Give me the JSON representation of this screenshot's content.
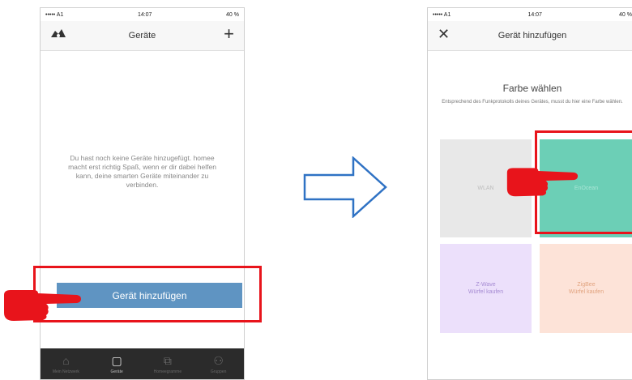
{
  "left_screen": {
    "status": {
      "carrier": "••••• A1",
      "time": "14:07",
      "battery": "40 %"
    },
    "nav": {
      "title": "Geräte",
      "left_icon": "homee-logo-icon",
      "right_icon": "plus-icon"
    },
    "empty_message": "Du hast noch keine Geräte hinzugefügt. homee macht erst richtig Spaß, wenn er dir dabei helfen kann, deine smarten Geräte miteinander zu verbinden.",
    "add_button_label": "Gerät hinzufügen",
    "tabs": [
      {
        "label": "Mein Netzwerk",
        "icon": "home-icon",
        "active": false
      },
      {
        "label": "Geräte",
        "icon": "devices-icon",
        "active": true
      },
      {
        "label": "Homeegramme",
        "icon": "homeegram-icon",
        "active": false
      },
      {
        "label": "Gruppen",
        "icon": "groups-icon",
        "active": false
      }
    ]
  },
  "right_screen": {
    "status": {
      "carrier": "••••• A1",
      "time": "14:07",
      "battery": "40 %"
    },
    "nav": {
      "title": "Gerät hinzufügen",
      "left_icon": "close-icon"
    },
    "heading": "Farbe wählen",
    "description": "Entsprechend des Funkprotokolls deines Gerätes, musst du hier eine Farbe wählen.",
    "tiles": [
      {
        "label": "WLAN",
        "color": "#e8e8e8"
      },
      {
        "label": "EnOcean",
        "color": "#6ccfb6"
      },
      {
        "label": "Z-Wave\nWürfel kaufen",
        "color": "#ece0fb"
      },
      {
        "label": "ZigBee\nWürfel kaufen",
        "color": "#fde3d8"
      }
    ]
  },
  "colors": {
    "accent_button": "#5f94c2",
    "highlight": "#e8141b",
    "arrow": "#2f72c4",
    "tab_bar": "#2b2b2b"
  }
}
